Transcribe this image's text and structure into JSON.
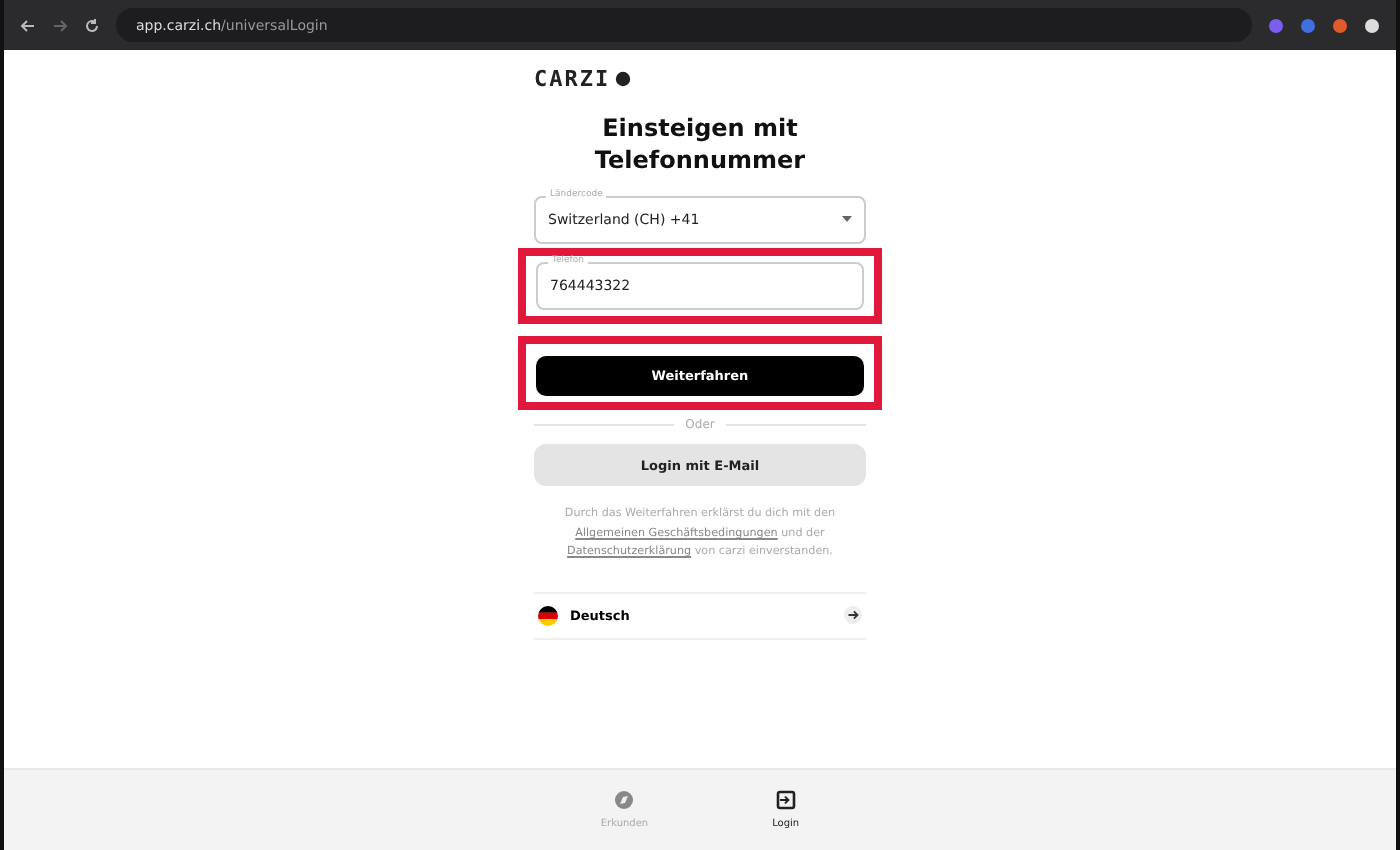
{
  "browser": {
    "url_host": "app.carzi.ch",
    "url_path": "/universalLogin"
  },
  "logo": "CARZI",
  "title": "Einsteigen mit Telefonnummer",
  "country_field": {
    "label": "Ländercode",
    "value": "Switzerland (CH) +41"
  },
  "phone_field": {
    "label": "Telefon",
    "value": "764443322",
    "highlighted": true
  },
  "continue_button": {
    "label": "Weiterfahren",
    "highlighted": true
  },
  "divider_text": "Oder",
  "email_button": "Login mit E-Mail",
  "legal": {
    "before": "Durch das Weiterfahren erklärst du dich mit den",
    "link_1": "Allgemeinen Geschäftsbedingungen",
    "middle": "und der",
    "link_2": "Datenschutzerklärung",
    "after": "von carzi einverstanden."
  },
  "language": {
    "label": "Deutsch"
  },
  "bottom_nav": [
    {
      "label": "Erkunden",
      "kind": "explore",
      "selected": false
    },
    {
      "label": "Login",
      "kind": "login",
      "selected": true
    }
  ]
}
